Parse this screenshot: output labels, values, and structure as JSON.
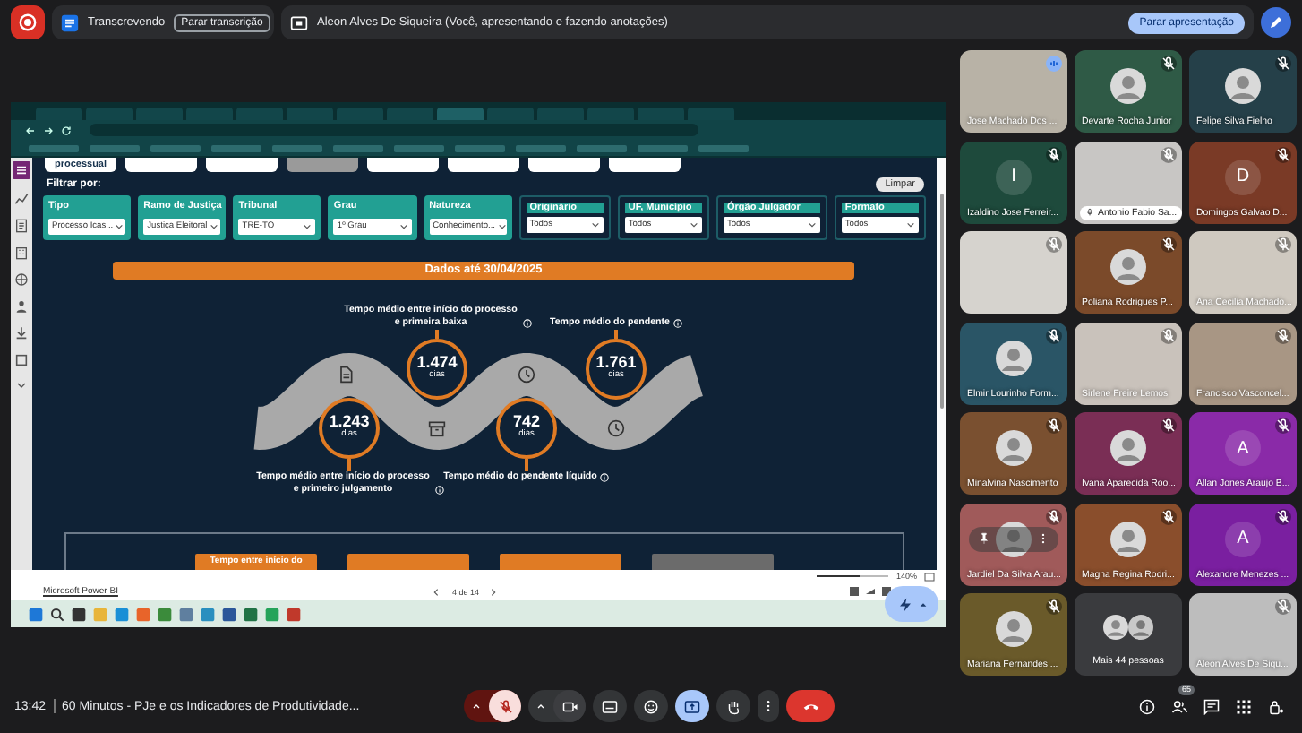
{
  "top_bar": {
    "recording": true,
    "transcription": {
      "status": "Transcrevendo",
      "button": "Parar transcrição"
    },
    "presentation": {
      "text": "Aleon Alves De Siqueira (Você, apresentando e fazendo anotações)",
      "button": "Parar apresentação"
    }
  },
  "shared_screen": {
    "dashboard": {
      "nav_buttons": [
        {
          "label": "processual",
          "color": "#ffffff"
        },
        {
          "color": "#ffffff"
        },
        {
          "color": "#ffffff"
        },
        {
          "color": "#9a9a9a"
        },
        {
          "color": "#ffffff"
        },
        {
          "color": "#ffffff"
        },
        {
          "color": "#ffffff"
        },
        {
          "color": "#ffffff"
        }
      ],
      "filter_title": "Filtrar por:",
      "clear_button": "Limpar",
      "filters": [
        {
          "kind": "filled",
          "label": "Tipo",
          "value": "Processo Icas..."
        },
        {
          "kind": "filled",
          "label": "Ramo de Justiça",
          "value": "Justiça Eleitoral"
        },
        {
          "kind": "filled",
          "label": "Tribunal",
          "value": "TRE-TO"
        },
        {
          "kind": "filled",
          "label": "Grau",
          "value": "1º Grau"
        },
        {
          "kind": "filled",
          "label": "Natureza",
          "value": "Conhecimento..."
        },
        {
          "kind": "outlined",
          "label": "Originário",
          "value": "Todos"
        },
        {
          "kind": "outlined",
          "label": "UF, Município",
          "value": "Todos"
        },
        {
          "kind": "outlined",
          "label": "Órgão Julgador",
          "value": "Todos"
        },
        {
          "kind": "outlined",
          "label": "Formato",
          "value": "Todos"
        }
      ],
      "banner": "Dados até 30/04/2025",
      "metrics": [
        {
          "kind": "top",
          "value": "1.474",
          "unit": "dias",
          "label": "Tempo médio entre início do processo e primeira baixa"
        },
        {
          "kind": "top",
          "value": "1.761",
          "unit": "dias",
          "label": "Tempo médio do pendente"
        },
        {
          "kind": "bottom",
          "value": "1.243",
          "unit": "dias",
          "label": "Tempo médio entre início do processo e primeiro julgamento"
        },
        {
          "kind": "bottom",
          "value": "742",
          "unit": "dias",
          "label": "Tempo médio do pendente líquido"
        }
      ],
      "bottom_tabs": [
        {
          "label": "Tempo entre início do",
          "color": "#e07b24"
        },
        {
          "color": "#e07b24"
        },
        {
          "color": "#e07b24"
        },
        {
          "color": "#6b6b6b"
        }
      ]
    },
    "footer": {
      "brand": "Microsoft Power BI",
      "page": "4 de 14",
      "zoom": "140%",
      "zoom_slider": {
        "level": 0.6
      }
    },
    "browser_tabs": [
      {
        "selected": false
      },
      {
        "selected": false
      },
      {
        "selected": false
      },
      {
        "selected": false
      },
      {
        "selected": false
      },
      {
        "selected": false
      },
      {
        "selected": false
      },
      {
        "selected": false
      },
      {
        "selected": true
      },
      {
        "selected": false
      },
      {
        "selected": false
      },
      {
        "selected": false
      },
      {
        "selected": false
      },
      {
        "selected": false
      }
    ]
  },
  "participants": [
    {
      "kind": "video",
      "name": "Jose Machado Dos ...",
      "muted": false,
      "color": "#b8b2a6"
    },
    {
      "kind": "avatar",
      "name": "Devarte Rocha Junior",
      "muted": true,
      "color": "#2f5a46"
    },
    {
      "kind": "avatar",
      "name": "Felipe Silva Fielho",
      "muted": true,
      "color": "#254049"
    },
    {
      "kind": "letter",
      "letter": "I",
      "name": "Izaldino Jose Ferreir...",
      "muted": true,
      "color": "#1e4a3c"
    },
    {
      "kind": "video",
      "name": "Antonio Fabio Sa...",
      "muted": true,
      "highlighted": true,
      "color": "#c8c6c4"
    },
    {
      "kind": "letter",
      "letter": "D",
      "name": "Domingos Galvao D...",
      "muted": true,
      "color": "#7a3a26"
    },
    {
      "kind": "video",
      "muted": true,
      "color": "#d6d3ce"
    },
    {
      "kind": "avatar",
      "name": "Poliana Rodrigues P...",
      "muted": true,
      "color": "#7b4a2a"
    },
    {
      "kind": "video",
      "name": "Ana Cecilia Machado...",
      "muted": true,
      "color": "#cfc9c0"
    },
    {
      "kind": "avatar",
      "name": "Elmir Lourinho Form...",
      "muted": true,
      "color": "#2a5566"
    },
    {
      "kind": "video",
      "name": "Sirlene Freire Lemos",
      "muted": true,
      "color": "#c9c2bb"
    },
    {
      "kind": "video",
      "name": "Francisco Vasconcel...",
      "muted": true,
      "color": "#a89684"
    },
    {
      "kind": "avatar",
      "name": "Minalvina Nascimento",
      "muted": true,
      "color": "#7a5030"
    },
    {
      "kind": "avatar",
      "name": "Ivana Aparecida Roo...",
      "muted": true,
      "color": "#7a2e55"
    },
    {
      "kind": "letter",
      "letter": "A",
      "name": "Allan Jones Araujo B...",
      "muted": true,
      "color": "#8a2aa8"
    },
    {
      "kind": "avatar",
      "name": "Jardiel Da Silva Arau...",
      "muted": true,
      "controls_shown": true,
      "color": "#a05a5a"
    },
    {
      "kind": "avatar",
      "name": "Magna Regina Rodri...",
      "muted": true,
      "color": "#8a4e2c"
    },
    {
      "kind": "letter",
      "letter": "A",
      "name": "Alexandre Menezes ...",
      "muted": true,
      "color": "#7a1fa0"
    },
    {
      "kind": "avatar",
      "name": "Mariana Fernandes ...",
      "muted": true,
      "color": "#6a5a2a"
    },
    {
      "kind": "overflow",
      "name": "Mais 44 pessoas",
      "color": "#3a3b3e"
    },
    {
      "kind": "video",
      "name": "Aleon Alves De Siqu...",
      "muted": true,
      "color": "#bdbdbd"
    }
  ],
  "bottom_bar": {
    "time": "13:42",
    "meeting_title": "60 Minutos - PJe e os Indicadores de Produtividade...",
    "mic_muted": true,
    "presenting": true,
    "people_count": "65"
  }
}
